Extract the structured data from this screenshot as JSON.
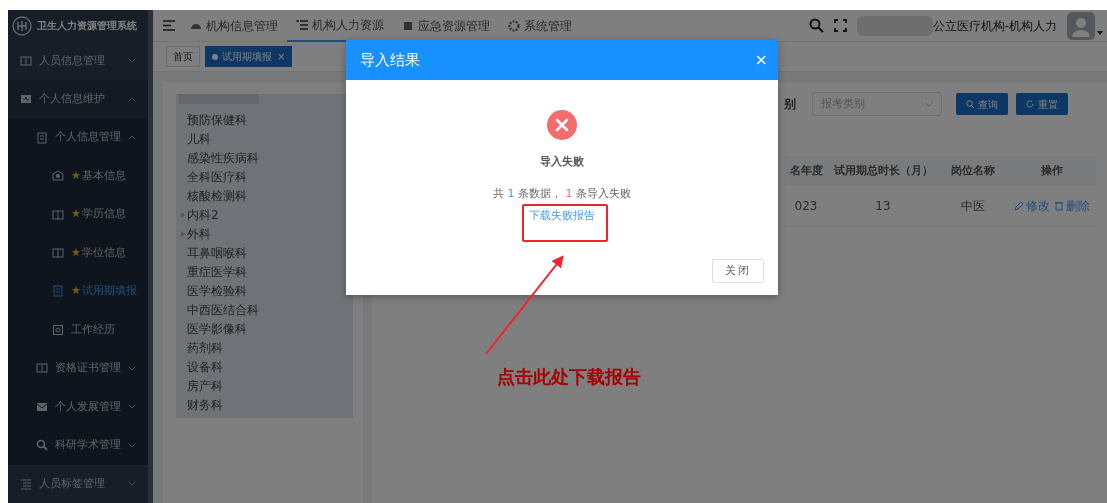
{
  "app": {
    "title": "卫生人力资源管理系统"
  },
  "top_nav": [
    {
      "label": "机构信息管理",
      "selected": false
    },
    {
      "label": "机构人力资源",
      "selected": true
    },
    {
      "label": "应急资源管理",
      "selected": false
    },
    {
      "label": "系统管理",
      "selected": false
    }
  ],
  "user": {
    "org": "公立医疗机构-机构人力"
  },
  "sidebar": {
    "items": [
      {
        "label": "人员信息管理",
        "expanded": false,
        "selected": false
      },
      {
        "label": "个人信息维护",
        "expanded": true,
        "selected": false,
        "children": [
          {
            "label": "个人信息管理",
            "expanded": true,
            "selected": false,
            "children": [
              {
                "label": "基本信息",
                "star": "★",
                "selected": false
              },
              {
                "label": "学历信息",
                "star": "★",
                "selected": false
              },
              {
                "label": "学位信息",
                "star": "★",
                "selected": false
              },
              {
                "label": "试用期填报",
                "star": "★",
                "selected": true
              },
              {
                "label": "工作经历",
                "selected": false
              }
            ]
          },
          {
            "label": "资格证书管理",
            "expanded": false,
            "selected": false
          },
          {
            "label": "个人发展管理",
            "expanded": false,
            "selected": false
          },
          {
            "label": "科研学术管理",
            "expanded": false,
            "selected": false
          }
        ]
      },
      {
        "label": "人员标签管理",
        "expanded": false,
        "selected": false
      }
    ]
  },
  "page_tabs": [
    {
      "label": "首页",
      "selected": false
    },
    {
      "label": "试用期填报",
      "selected": true,
      "close": "×"
    }
  ],
  "dept_tree": [
    {
      "label": "预防保健科",
      "expandable": false
    },
    {
      "label": "儿科",
      "expandable": false
    },
    {
      "label": "感染性疾病科",
      "expandable": false
    },
    {
      "label": "全科医疗科",
      "expandable": false
    },
    {
      "label": "核酸检测科",
      "expandable": false
    },
    {
      "label": "内科2",
      "expandable": true
    },
    {
      "label": "外科",
      "expandable": true
    },
    {
      "label": "耳鼻咽喉科",
      "expandable": false
    },
    {
      "label": "重症医学科",
      "expandable": false
    },
    {
      "label": "医学检验科",
      "expandable": false
    },
    {
      "label": "中西医结合科",
      "expandable": false
    },
    {
      "label": "医学影像科",
      "expandable": false
    },
    {
      "label": "药剂科",
      "expandable": false
    },
    {
      "label": "设备科",
      "expandable": false
    },
    {
      "label": "房产科",
      "expandable": false
    },
    {
      "label": "财务科",
      "expandable": false
    }
  ],
  "filter": {
    "label": "别",
    "select_placeholder": "报考类别",
    "buttons": [
      {
        "label": "查询"
      },
      {
        "label": "重置"
      }
    ]
  },
  "table": {
    "columns": [
      "名年度",
      "试用期总时长（月）",
      "岗位名称",
      "操作"
    ],
    "rows": [
      {
        "cells": [
          "023",
          "13",
          "中医"
        ],
        "actions": [
          {
            "label": "修改"
          },
          {
            "label": "删除"
          }
        ]
      }
    ]
  },
  "dialog": {
    "title": "导入结果",
    "close": "×",
    "status": "导入失败",
    "summary": [
      {
        "text": "共 "
      },
      {
        "text": "1",
        "color": "#409eff"
      },
      {
        "text": " 条数据， "
      },
      {
        "text": "1",
        "color": "#f56c6c"
      },
      {
        "text": " 条导入失败"
      }
    ],
    "link": "下载失败报告",
    "button": "关闭"
  },
  "annotation": {
    "text": "点击此处下载报告"
  }
}
